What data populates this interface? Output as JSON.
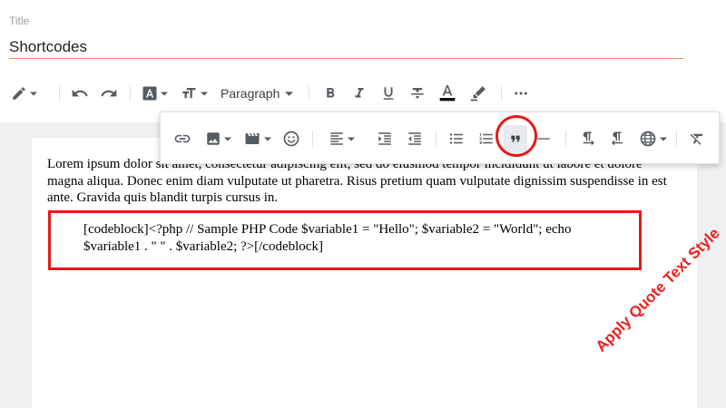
{
  "title": {
    "label": "Title",
    "value": "Shortcodes"
  },
  "toolbar": {
    "paragraph_label": "Paragraph"
  },
  "content": {
    "paragraph": "Lorem ipsum dolor sit amet, consectetur adipiscing elit, sed do eiusmod tempor incididunt ut labore et dolore magna aliqua. Donec enim diam vulputate ut pharetra. Risus pretium quam vulputate dignissim suspendisse in est ante. Gravida quis blandit turpis cursus in.",
    "codeblock": "[codeblock]<?php // Sample PHP Code $variable1 = \"Hello\"; $variable2 = \"World\"; echo $variable1 . \" \" . $variable2; ?>[/codeblock]"
  },
  "annotation": {
    "text": "Apply Quote Text Style",
    "color": "#ee2020"
  },
  "colors": {
    "accent_underline": "#f0856b",
    "highlight_red": "#e41b1b",
    "icon": "#555b61"
  },
  "icons": {
    "main_toolbar": [
      "pen-icon",
      "undo-icon",
      "redo-icon",
      "font-color-icon",
      "text-size-icon",
      "bold-icon",
      "italic-icon",
      "underline-icon",
      "strikethrough-icon",
      "text-color-icon",
      "highlighter-icon",
      "more-icon"
    ],
    "popup_toolbar": [
      "link-icon",
      "image-icon",
      "video-icon",
      "emoji-icon",
      "align-icon",
      "indent-icon",
      "outdent-icon",
      "bullet-list-icon",
      "numbered-list-icon",
      "quote-icon",
      "horizontal-line-icon",
      "ltr-icon",
      "rtl-icon",
      "language-icon",
      "clear-format-icon"
    ]
  }
}
